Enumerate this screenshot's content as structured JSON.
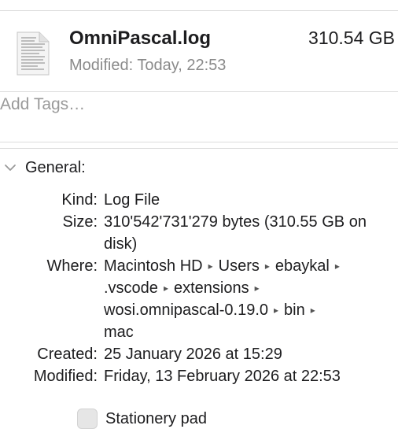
{
  "file": {
    "name": "OmniPascal.log",
    "size": "310.54 GB",
    "modified": "Modified: Today, 22:53"
  },
  "tags": {
    "placeholder": "Add Tags…"
  },
  "general": {
    "title": "General:",
    "kind_label": "Kind:",
    "kind_value": "Log File",
    "size_label": "Size:",
    "size_value": "310'542'731'279 bytes (310.55 GB on disk)",
    "where_label": "Where:",
    "where_path": [
      "Macintosh HD",
      "Users",
      "ebaykal",
      ".vscode",
      "extensions",
      "wosi.omnipascal-0.19.0",
      "bin",
      "mac"
    ],
    "created_label": "Created:",
    "created_value": "25 January 2026 at 15:29",
    "modified_label": "Modified:",
    "modified_value": "Friday, 13 February 2026 at 22:53"
  },
  "options": {
    "stationery_label": "Stationery pad"
  },
  "icons": {
    "file": "document-icon",
    "disclosure": "chevron-down-icon",
    "path_separator": "triangle-right-icon"
  }
}
